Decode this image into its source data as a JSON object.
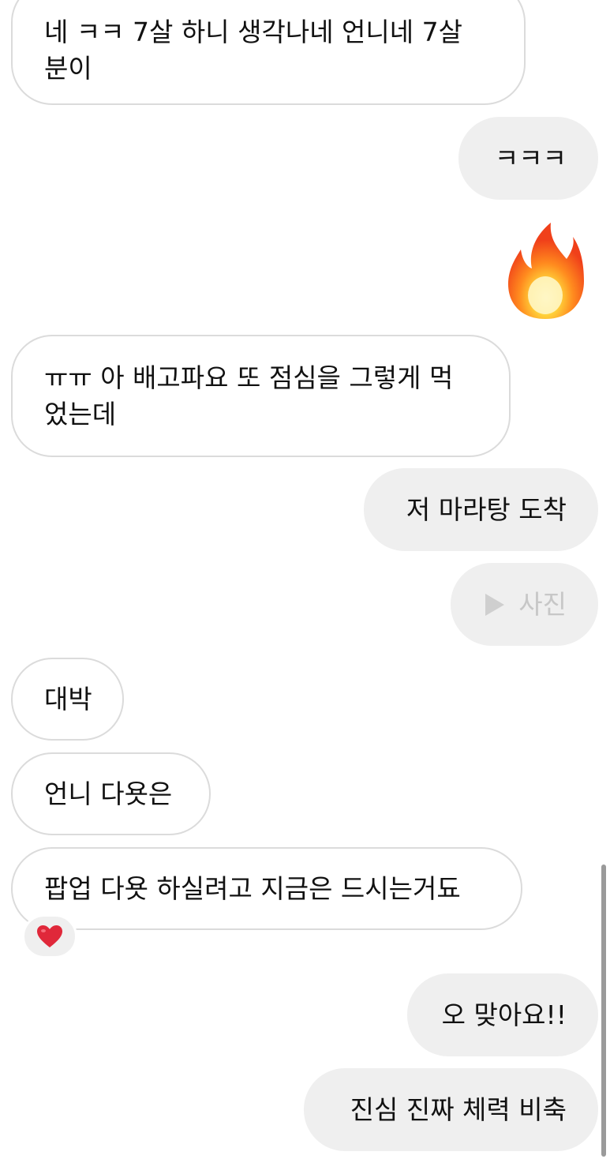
{
  "messages": [
    {
      "direction": "incoming",
      "text": "네 ㅋㅋ 7살 하니 생각나네 언니네 7살\n분이"
    },
    {
      "direction": "outgoing",
      "text": "ㅋㅋㅋ"
    },
    {
      "direction": "outgoing",
      "type": "emoji",
      "emoji": "fire-icon"
    },
    {
      "direction": "incoming",
      "text": "ㅠㅠ 아 배고파요 또 점심을 그렇게 먹\n었는데"
    },
    {
      "direction": "outgoing",
      "text": "저 마라탕 도착"
    },
    {
      "direction": "outgoing",
      "type": "photo",
      "text": "사진",
      "icon": "play-icon"
    },
    {
      "direction": "incoming",
      "text": "대박"
    },
    {
      "direction": "incoming",
      "text": "언니 다욧은"
    },
    {
      "direction": "incoming",
      "text": "팝업 다욧 하실려고 지금은 드시는거됴",
      "reaction": "heart-icon"
    },
    {
      "direction": "outgoing",
      "text": "오 맞아요!!"
    },
    {
      "direction": "outgoing",
      "text": "진심 진짜 체력 비축"
    }
  ],
  "colors": {
    "incoming_bg": "#ffffff",
    "incoming_border": "#dbdbdb",
    "outgoing_bg": "#efefef",
    "photo_text": "#c7c7c7",
    "heart": "#e0283a"
  }
}
